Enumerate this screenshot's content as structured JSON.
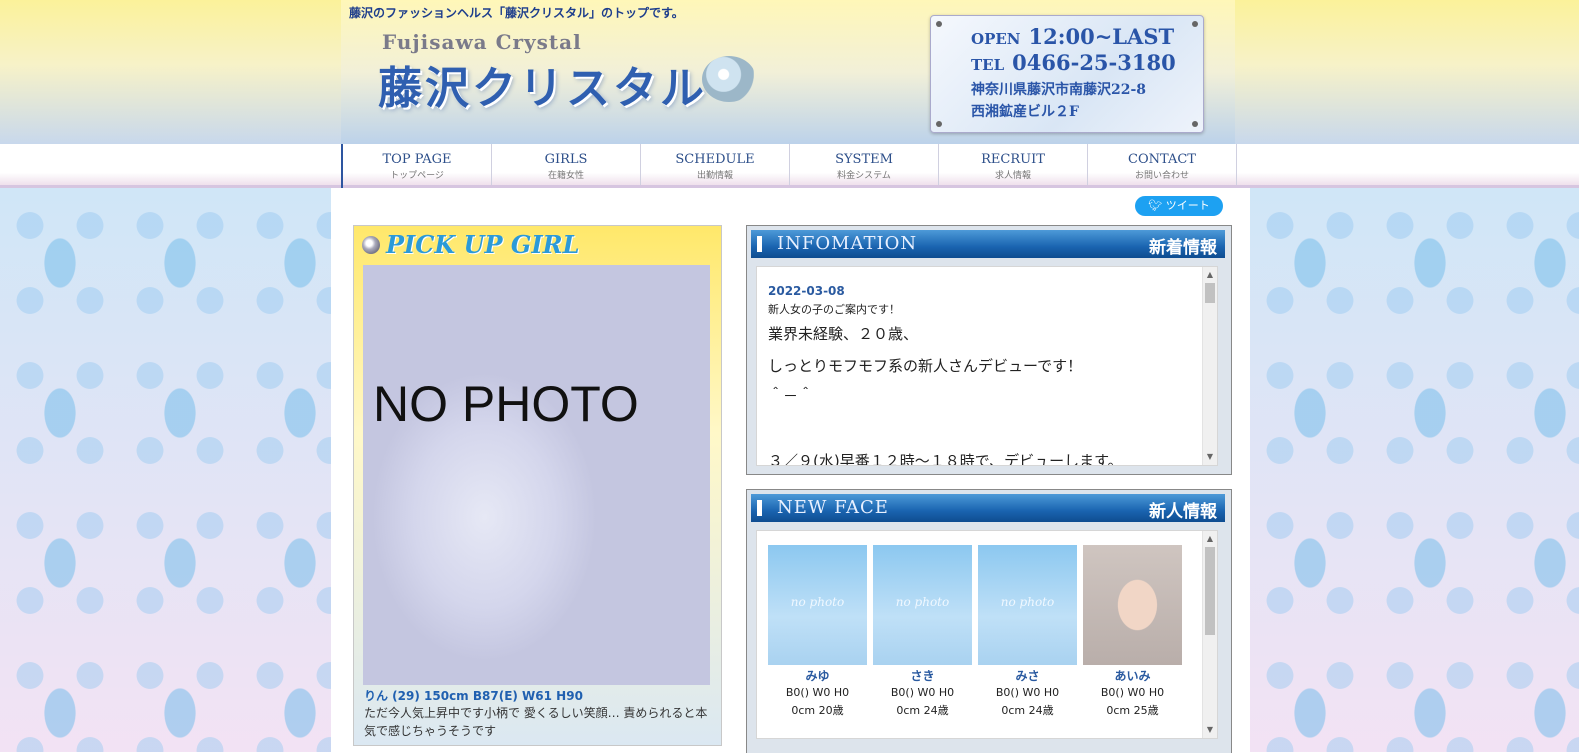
{
  "header": {
    "tagline": "藤沢のファッションヘルス「藤沢クリスタル」のトップです。",
    "logo_en": "Fujisawa Crystal",
    "logo_jp": "藤沢クリスタル",
    "open_label": "OPEN",
    "open_hours": "12:00~LAST",
    "tel_label": "TEL",
    "tel": "0466-25-3180",
    "address1": "神奈川県藤沢市南藤沢22-8",
    "address2": "西湘鉱産ビル２F"
  },
  "nav": [
    {
      "en": "TOP PAGE",
      "jp": "トップページ"
    },
    {
      "en": "GIRLS",
      "jp": "在籍女性"
    },
    {
      "en": "SCHEDULE",
      "jp": "出勤情報"
    },
    {
      "en": "SYSTEM",
      "jp": "料金システム"
    },
    {
      "en": "RECRUIT",
      "jp": "求人情報"
    },
    {
      "en": "CONTACT",
      "jp": "お問い合わせ"
    }
  ],
  "tweet": "ツイート",
  "pickup": {
    "title": "PICK UP GIRL",
    "photo_text": "NO PHOTO",
    "profile": "りん (29) 150cm B87(E) W61 H90",
    "description": "ただ今人気上昇中です小柄で 愛くるしい笑顔… 責められると本気で感じちゃうそうです"
  },
  "info": {
    "title_en": "INFOMATION",
    "title_jp": "新着情報",
    "date": "2022-03-08",
    "headline": "新人女の子のご案内です！",
    "lines": [
      "業界未経験、２０歳、",
      "しっとりモフモフ系の新人さんデビューです！",
      "＾－＾",
      "３／９(水)早番１２時～１８時で、デビューします。"
    ]
  },
  "newface": {
    "title_en": "NEW FACE",
    "title_jp": "新人情報",
    "no_photo": "no photo",
    "girls": [
      {
        "name": "みゆ",
        "size": "B0() W0 H0",
        "age": "0cm 20歳"
      },
      {
        "name": "さき",
        "size": "B0() W0 H0",
        "age": "0cm 24歳"
      },
      {
        "name": "みさ",
        "size": "B0() W0 H0",
        "age": "0cm 24歳"
      },
      {
        "name": "あいみ",
        "size": "B0() W0 H0",
        "age": "0cm 25歳"
      }
    ]
  }
}
